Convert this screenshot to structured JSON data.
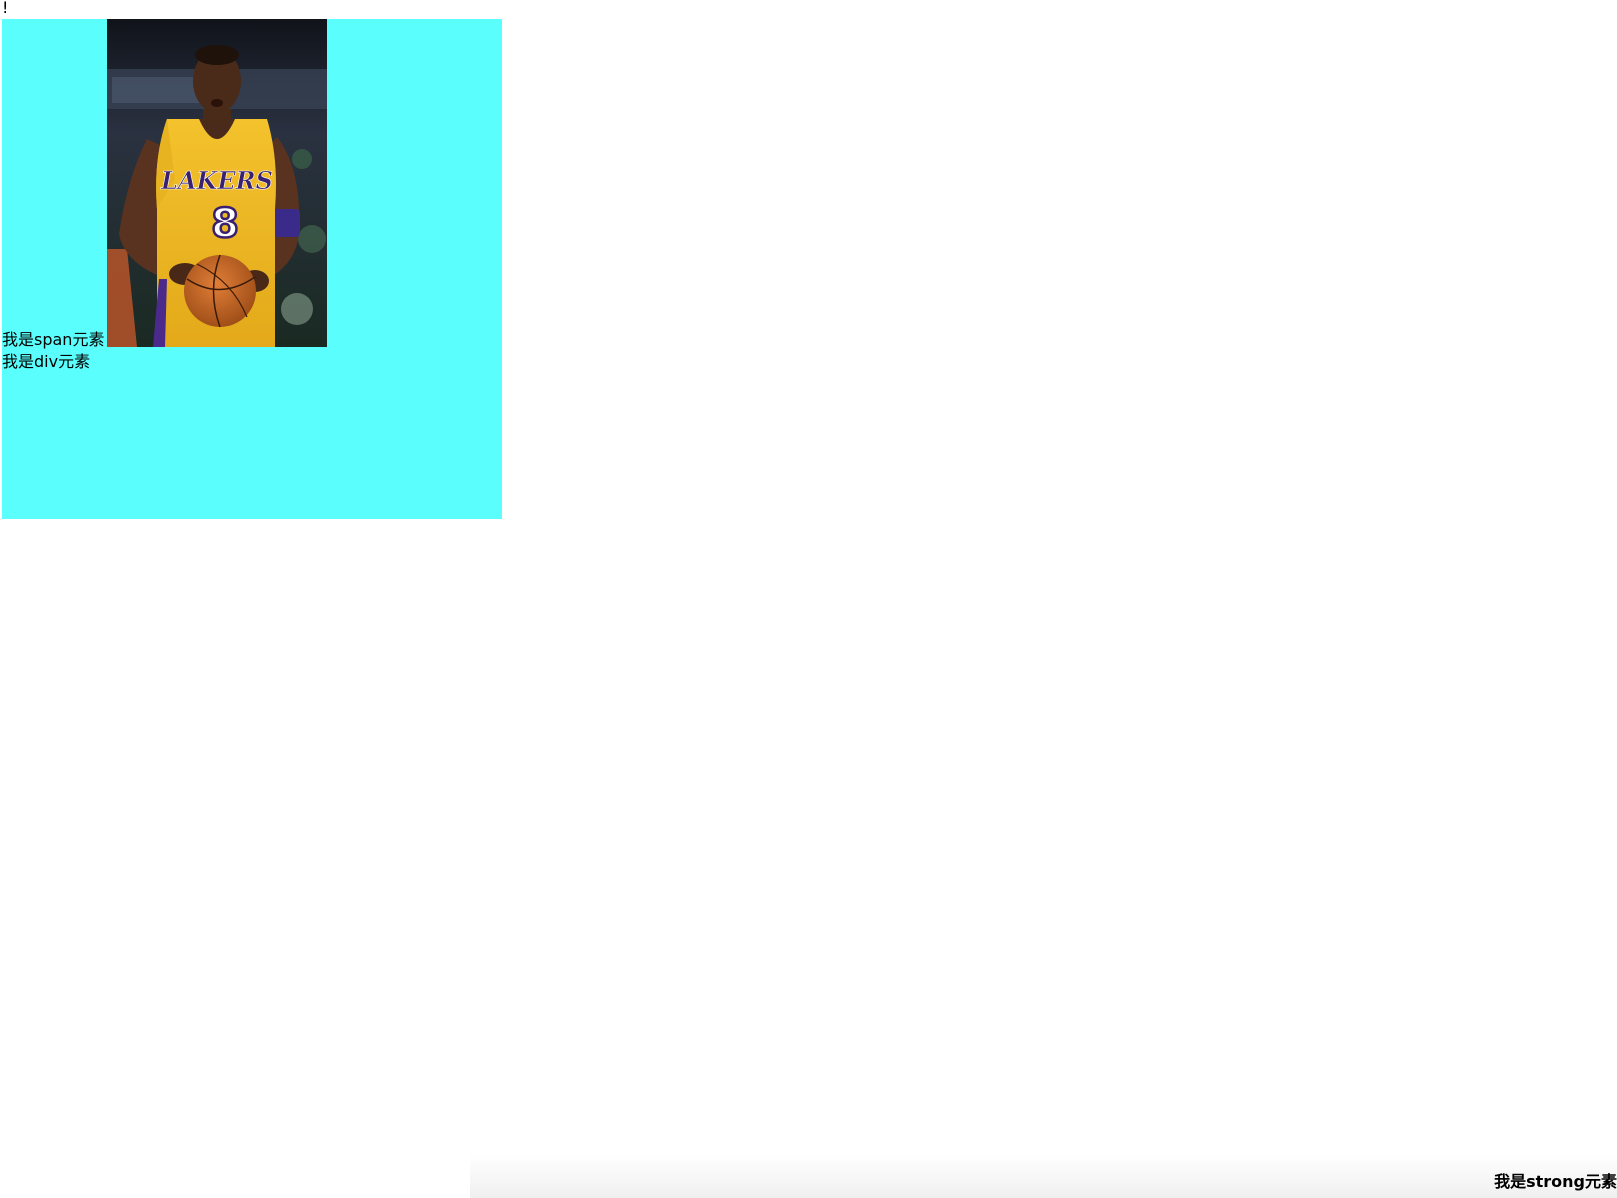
{
  "page": {
    "exclamation": "!",
    "box_color": "#5afffd"
  },
  "box": {
    "span_text": "我是span元素",
    "div_text": "我是div元素"
  },
  "photo": {
    "icon": "basketball-player-photo"
  },
  "footer": {
    "strong_text": "我是strong元素"
  }
}
